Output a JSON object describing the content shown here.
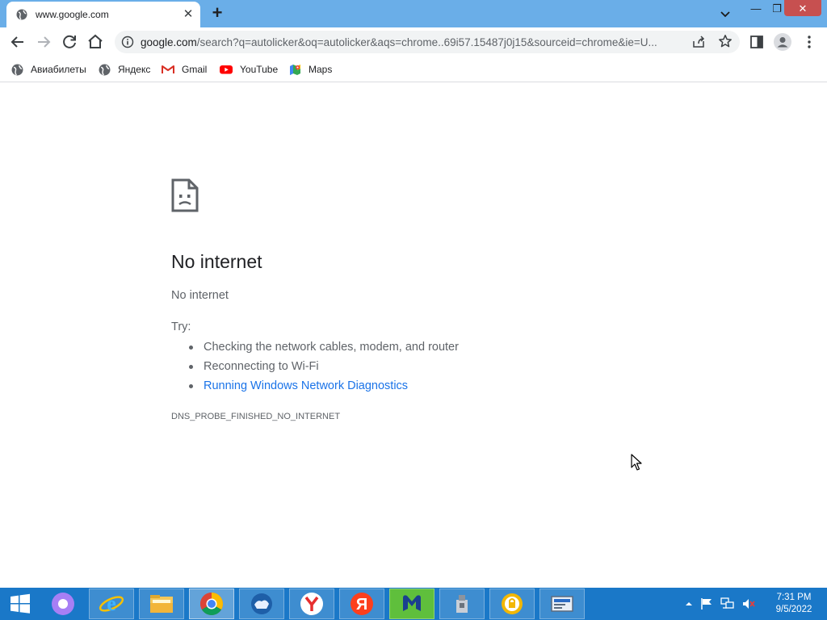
{
  "browser": {
    "tab": {
      "title": "www.google.com"
    },
    "address_bar": {
      "host": "google.com",
      "path": "/search?q=autolicker&oq=autolicker&aqs=chrome..69i57.15487j0j15&sourceid=chrome&ie=U..."
    },
    "bookmarks": [
      {
        "label": "Авиабилеты",
        "icon": "globe-icon"
      },
      {
        "label": "Яндекс",
        "icon": "globe-icon"
      },
      {
        "label": "Gmail",
        "icon": "gmail-icon"
      },
      {
        "label": "YouTube",
        "icon": "youtube-icon"
      },
      {
        "label": "Maps",
        "icon": "maps-icon"
      }
    ]
  },
  "error_page": {
    "title": "No internet",
    "subtitle": "No internet",
    "try_label": "Try:",
    "suggestions": [
      "Checking the network cables, modem, and router",
      "Reconnecting to Wi-Fi",
      "Running Windows Network Diagnostics"
    ],
    "error_code": "DNS_PROBE_FINISHED_NO_INTERNET"
  },
  "taskbar": {
    "apps": [
      "start-icon",
      "alice-icon",
      "internet-explorer-icon",
      "file-explorer-icon",
      "chrome-icon",
      "vpn-icon",
      "yandex-browser-icon",
      "yandex-icon",
      "malwarebytes-icon",
      "usb-icon",
      "lock-app-icon",
      "network-app-icon"
    ],
    "clock": {
      "time": "7:31 PM",
      "date": "9/5/2022"
    }
  },
  "colors": {
    "tabstrip": "#6aaee8",
    "taskbar": "#1a78c8",
    "link": "#1a73e8"
  }
}
